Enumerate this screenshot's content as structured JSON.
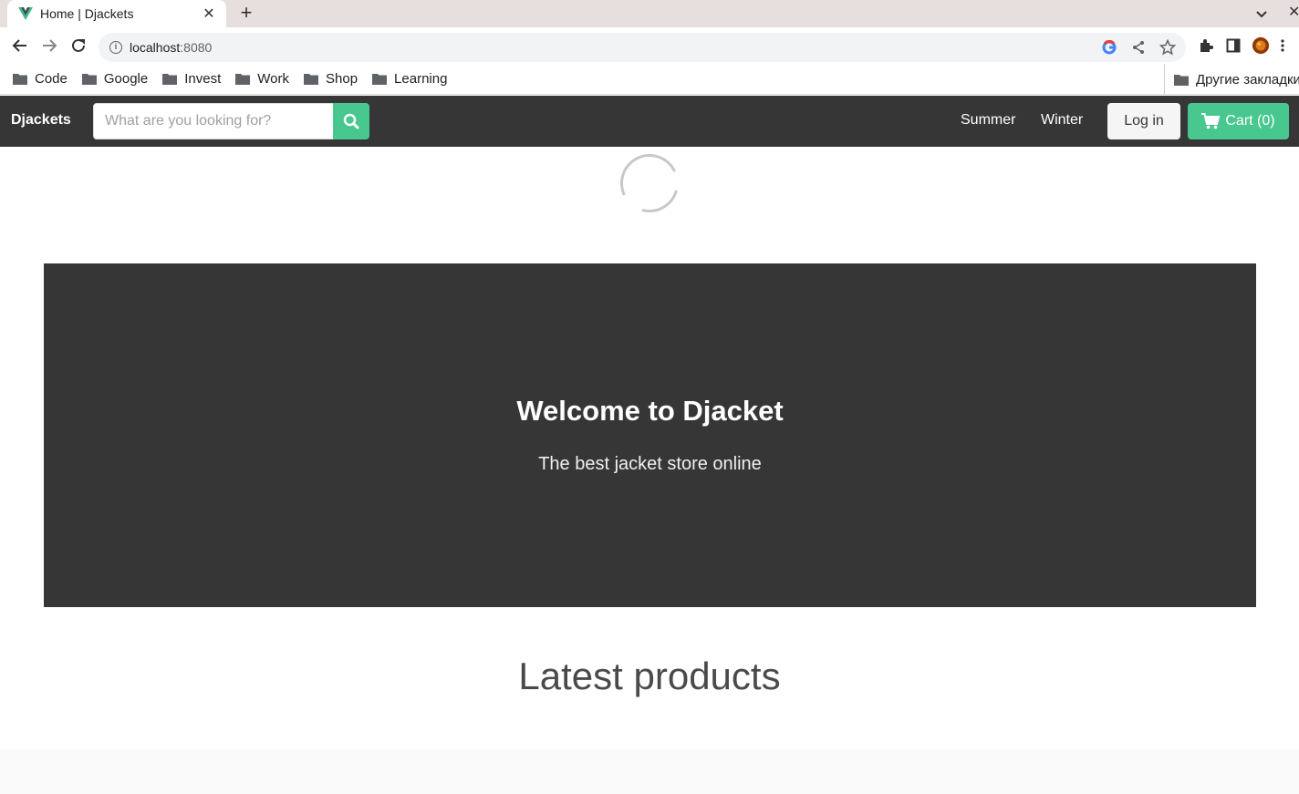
{
  "browser": {
    "tab_title": "Home | Djackets",
    "url_host": "localhost",
    "url_port": ":8080",
    "bookmarks": [
      "Code",
      "Google",
      "Invest",
      "Work",
      "Shop",
      "Learning"
    ],
    "other_bookmarks": "Другие закладки"
  },
  "navbar": {
    "brand": "Djackets",
    "search_placeholder": "What are you looking for?",
    "links": [
      "Summer",
      "Winter"
    ],
    "login_label": "Log in",
    "cart_label": "Cart (0)"
  },
  "hero": {
    "title": "Welcome to Djacket",
    "subtitle": "The best jacket store online"
  },
  "sections": {
    "latest_title": "Latest products"
  },
  "colors": {
    "dark": "#363636",
    "accent": "#48c78e"
  }
}
